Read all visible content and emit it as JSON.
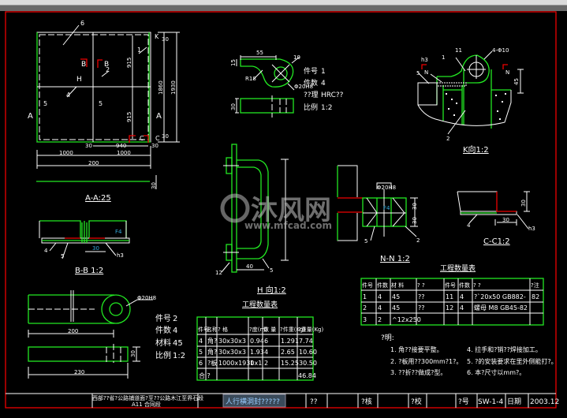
{
  "colors": {
    "background": "#000000",
    "frame": "#e00000",
    "outline": "#22e822",
    "line": "#ffffff",
    "highlight": "#3a4a5a"
  },
  "plan": {
    "title": "A-A:25",
    "labels": [
      "6",
      "1",
      "2",
      "4",
      "5",
      "5",
      "H",
      "B",
      "B",
      "A",
      "A",
      "C",
      "C",
      "K"
    ],
    "dims": {
      "h1": "915",
      "h2": "915",
      "v1": "1860",
      "v2": "1930",
      "top_small": "30",
      "bot_small": "30",
      "b30a": "30",
      "b940": "940",
      "b30b": "30",
      "b1000a": "1000",
      "b1000b": "1000",
      "total": "200",
      "bar": "30"
    }
  },
  "bb": {
    "title": "B-B 1:2",
    "labels": [
      "4",
      "5",
      "30",
      "h3",
      "F4"
    ]
  },
  "part2": {
    "hole": "Φ20H8",
    "len1": "200",
    "len2": "230",
    "thk": "30",
    "spec": [
      {
        "k": "件号",
        "v": "2"
      },
      {
        "k": "件数",
        "v": "4"
      },
      {
        "k": "材料",
        "v": "45"
      },
      {
        "k": "比例",
        "v": "1:2"
      }
    ]
  },
  "part1": {
    "dim_len": "55",
    "dim_r": "R18",
    "dim_t": "15",
    "dim_10": "10",
    "hole": "Φ20H8",
    "thk": "30",
    "spec": [
      {
        "k": "件号",
        "v": "1"
      },
      {
        "k": "件数",
        "v": "4"
      },
      {
        "k": "??理",
        "v": "HRC??"
      },
      {
        "k": "比例",
        "v": "1:2"
      }
    ]
  },
  "hview": {
    "title": "H 向1:2",
    "labels": [
      "40",
      "12",
      "5",
      "1"
    ]
  },
  "nn": {
    "title": "N-N 1:2",
    "hole": "Φ20H8",
    "d1": "30",
    "d2": "30",
    "l1": "5",
    "l2": "2",
    "mark": "F4"
  },
  "kview": {
    "title": "K向1:2",
    "labels": [
      "11",
      "4-Φ10",
      "h3",
      "1",
      "5",
      "N",
      "N",
      "45",
      "2"
    ]
  },
  "cc": {
    "title": "C-C1:2",
    "labels": [
      "30",
      "30",
      "h3",
      "4"
    ]
  },
  "table1": {
    "title": "工程数量表",
    "headers": [
      "件号",
      "名称",
      "? 格",
      "?度(m)",
      "数 量",
      "?件重(Kg)",
      "?重量(Kg)"
    ],
    "rows": [
      [
        "4",
        "角?",
        "30x30x3",
        "0.94",
        "6",
        "1.291",
        "7.74"
      ],
      [
        "5",
        "角?",
        "30x30x3",
        "1.93",
        "4",
        "2.65",
        "10.60"
      ],
      [
        "6",
        "?板",
        "1000x1930x1",
        "1",
        "2",
        "15.25",
        "30.50"
      ]
    ],
    "total_label": "合 ?",
    "total_value": "46.84"
  },
  "table2": {
    "title": "工程数量表",
    "headers": [
      "件号",
      "件数",
      "材 料",
      "? ?",
      "件号",
      "件数",
      "? ?",
      "?注"
    ],
    "rows": [
      [
        "1",
        "4",
        "45",
        "??",
        "11",
        "4",
        "?`20x50  GB882-",
        "82"
      ],
      [
        "2",
        "4",
        "45",
        "??",
        "12",
        "4",
        "螺母  M8  GB45-82",
        ""
      ],
      [
        "3",
        "2",
        "^12x250",
        "",
        "",
        "",
        "",
        ""
      ]
    ]
  },
  "notes": {
    "title": "?明:",
    "items": [
      "1. 角??接要平整。",
      "2. ?板用??300mm?1?。",
      "3. ??折??做成?型。",
      "4. 拉手和?销??焊接加工。",
      "5. ?的安装要求在里外侧能打?。",
      "6. 本?尺寸以mm?。"
    ]
  },
  "titleblock": {
    "project_line1": "西部??省?公路铺道面?至??公路木江至界石段",
    "project_line2": "A11  合同段",
    "drawing_name": "人行横洞封?????",
    "c1": "??",
    "c2": "?核",
    "c3": "?校",
    "c4": "?号",
    "drawing_no": "SW-1-4",
    "date_label": "日期",
    "date": "2003.12"
  },
  "watermark": {
    "brand": "沐风网",
    "url": "www.mfcad.com"
  }
}
